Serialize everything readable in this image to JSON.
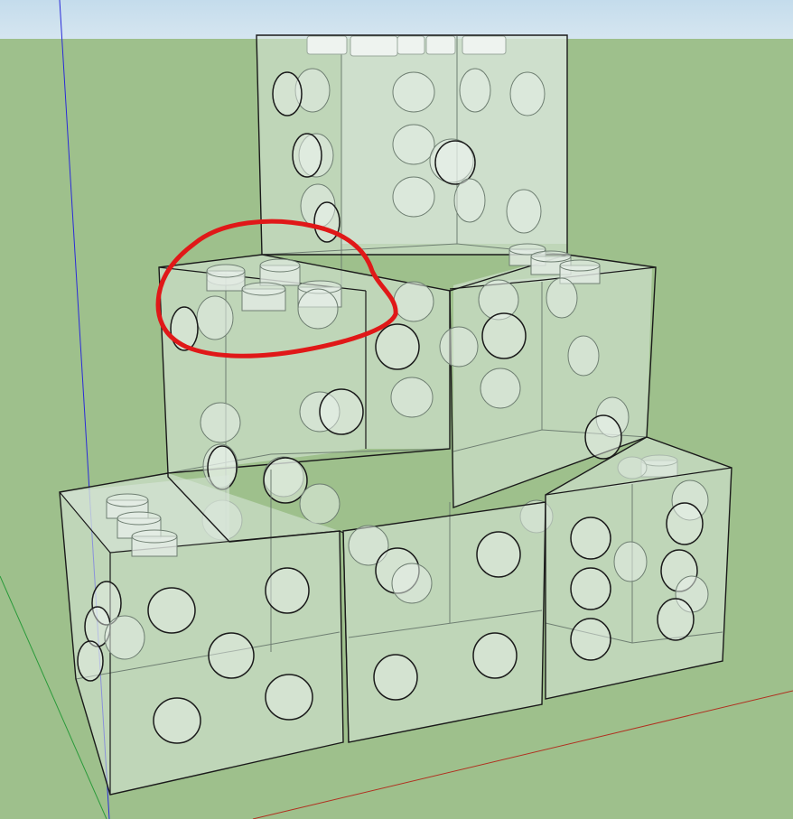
{
  "viewport": {
    "sky_color": "#d6e6f0",
    "sky_top_color": "#c4dcec",
    "ground_color": "#9ec08c",
    "red_axis_color": "#b03020",
    "green_axis_color": "#2a9a3a",
    "blue_axis_color": "#2a2ad8",
    "annotation_color": "#e01818"
  },
  "model": {
    "face_fill": "#dbe8dd",
    "face_opacity": 0.55,
    "edge_color": "#1a1a1a",
    "hidden_edge_color": "#6f7f72",
    "cubes": [
      "top-cube",
      "middle-left-cube",
      "middle-right-cube",
      "bottom-left-cube",
      "bottom-center-cube",
      "bottom-right-cube"
    ]
  },
  "annotation": {
    "shape": "freehand-ellipse",
    "marks": "highlighted-pegs"
  }
}
